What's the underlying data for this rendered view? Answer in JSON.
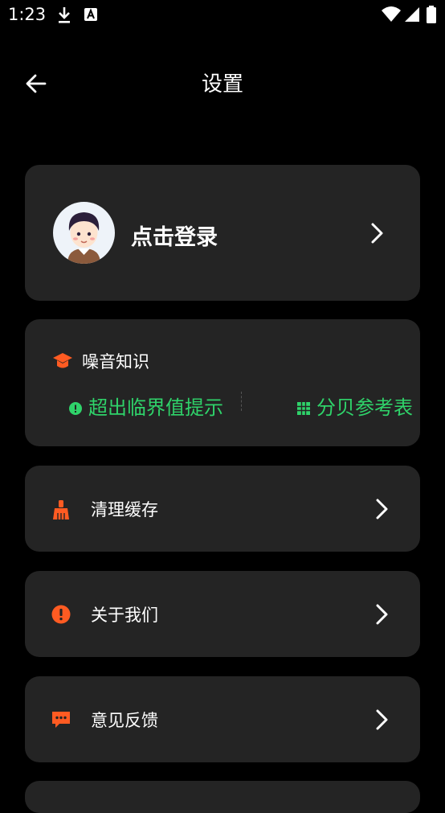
{
  "status": {
    "time": "1:23"
  },
  "header": {
    "title": "设置"
  },
  "login": {
    "label": "点击登录"
  },
  "knowledge": {
    "title": "噪音知识",
    "left_link": "超出临界值提示",
    "right_link": "分贝参考表"
  },
  "menu": [
    {
      "label": "清理缓存",
      "icon": "broom-icon"
    },
    {
      "label": "关于我们",
      "icon": "alert-icon"
    },
    {
      "label": "意见反馈",
      "icon": "feedback-icon"
    }
  ],
  "colors": {
    "accent": "#ff5b22",
    "green": "#2fd36a",
    "card": "#242424"
  }
}
